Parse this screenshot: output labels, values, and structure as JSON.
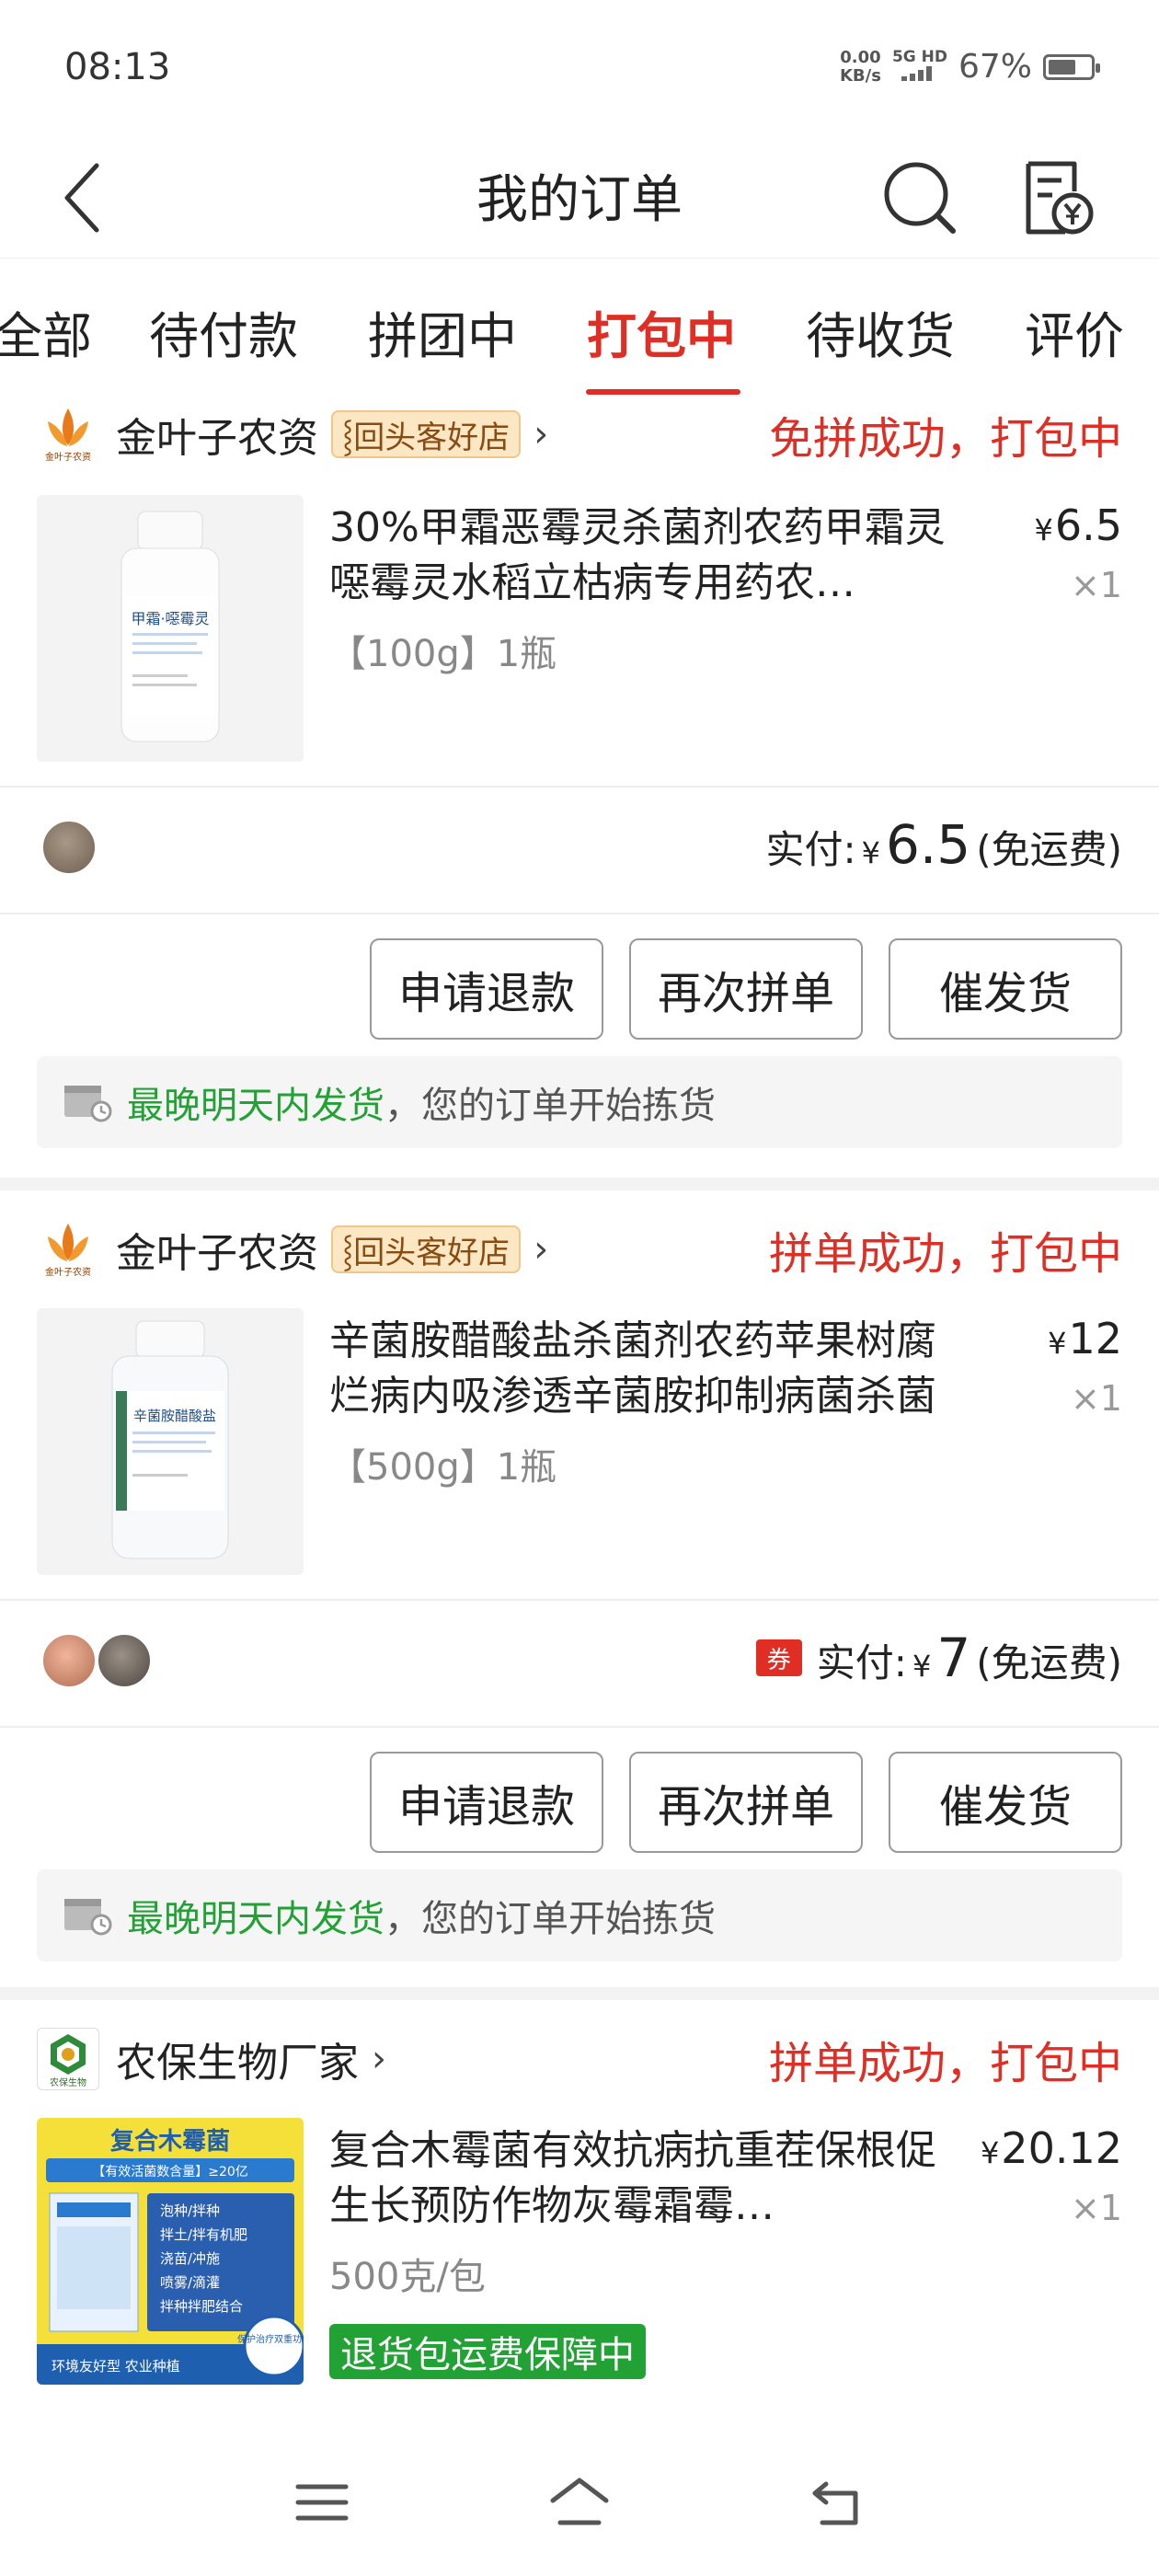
{
  "status_bar": {
    "time": "08:13",
    "net_speed_value": "0.00",
    "net_speed_unit": "KB/s",
    "network": "5G HD",
    "battery": "67%",
    "battery_level": 0.67
  },
  "header": {
    "title": "我的订单",
    "back_icon": "chevron-left-icon",
    "search_icon": "search-icon",
    "bill_icon": "receipt-yen-icon"
  },
  "tabs": [
    {
      "label": "全部"
    },
    {
      "label": "待付款"
    },
    {
      "label": "拼团中"
    },
    {
      "label": "打包中",
      "active": true
    },
    {
      "label": "待收货"
    },
    {
      "label": "评价"
    }
  ],
  "orders": [
    {
      "shop_name": "金叶子农资",
      "shop_logo_text": "金叶子农资",
      "shop_badge": "回头客好店",
      "status": "免拼成功，打包中",
      "product_title": "30%甲霜恶霉灵杀菌剂农药甲霜灵噁霉灵水稻立枯病专用药农…",
      "product_label": "甲霜·噁霉灵",
      "spec": "【100g】1瓶",
      "price_symbol": "¥",
      "price": "6.5",
      "qty": "×1",
      "total_label": "实付:",
      "total_symbol": "¥",
      "total_amount": "6.5",
      "total_note": "(免运费)",
      "buttons": [
        "申请退款",
        "再次拼单",
        "催发货"
      ],
      "ship_highlight": "最晚明天内发货",
      "ship_text": "，您的订单开始拣货"
    },
    {
      "shop_name": "金叶子农资",
      "shop_logo_text": "金叶子农资",
      "shop_badge": "回头客好店",
      "status": "拼单成功，打包中",
      "product_title": "辛菌胺醋酸盐杀菌剂农药苹果树腐烂病内吸渗透辛菌胺抑制病菌杀菌",
      "product_label": "辛菌胺醋酸盐",
      "spec": "【500g】1瓶",
      "price_symbol": "¥",
      "price": "12",
      "qty": "×1",
      "coupon": "券",
      "total_label": "实付:",
      "total_symbol": "¥",
      "total_amount": "7",
      "total_note": "(免运费)",
      "buttons": [
        "申请退款",
        "再次拼单",
        "催发货"
      ],
      "ship_highlight": "最晚明天内发货",
      "ship_text": "，您的订单开始拣货"
    },
    {
      "shop_name": "农保生物厂家",
      "shop_logo_text": "农保生物",
      "status": "拼单成功，打包中",
      "product_title": "复合木霉菌有效抗病抗重茬保根促生长预防作物灰霉霜霉…",
      "product_label": "复合木霉菌",
      "product_sublabel": "【有效活菌数含量】≥20亿",
      "product_lines": [
        "泡种/拌种",
        "拌土/拌有机肥",
        "浇苗/冲施",
        "喷雾/滴灌",
        "拌种拌肥结合"
      ],
      "product_footer": "环境友好型  农业种植",
      "product_footer_badge": "保护治疗双重功效",
      "spec": "500克/包",
      "price_symbol": "¥",
      "price": "20.12",
      "qty": "×1",
      "guarantee": "退货包运费保障中"
    }
  ],
  "nav_bar": {
    "menu_icon": "menu-icon",
    "home_icon": "home-icon",
    "back_icon": "back-icon"
  },
  "colors": {
    "accent": "#e02e24",
    "green": "#22a135"
  }
}
